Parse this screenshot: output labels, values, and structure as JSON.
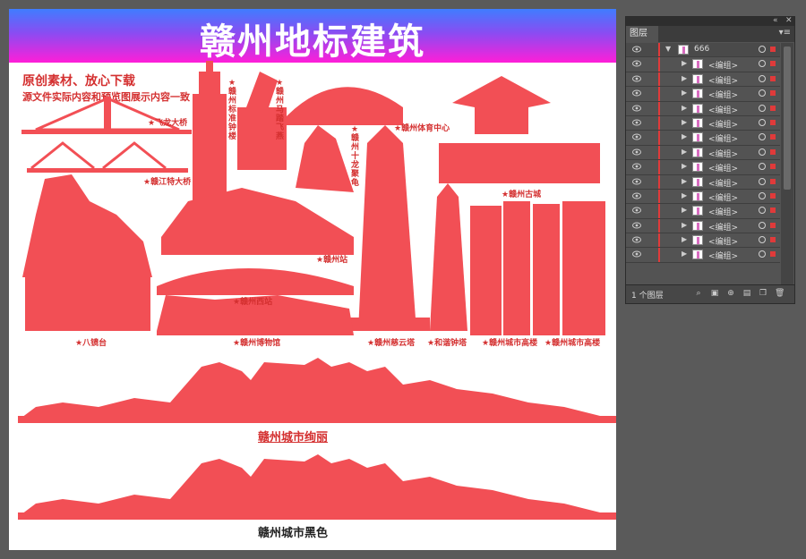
{
  "artboard": {
    "banner_title": "赣州地标建筑",
    "desc_line1": "原创素材、放心下载",
    "desc_line2": "源文件实际内容和预览图展示内容一致",
    "labels": {
      "feilong": "★飞龙大桥",
      "ganjiang": "★赣江特大桥",
      "biaozhun": "★赣州标准钟楼",
      "ma": "★赣州马踏飞燕",
      "tiyu": "★赣州体育中心",
      "shilong": "★赣州十龙聚龟",
      "gucheng": "★赣州古城",
      "station": "★赣州站",
      "west": "★赣州西站",
      "bajing": "★八镜台",
      "museum": "★赣州博物馆",
      "ciyun": "★赣州慈云塔",
      "hexie": "★和谐钟塔",
      "tower1": "★赣州城市高楼",
      "tower2": "★赣州城市高楼"
    },
    "caption_colorful": "赣州城市绚丽",
    "caption_black": "赣州城市黑色",
    "accent_color": "#f24f55"
  },
  "layers_panel": {
    "tab_label": "图层",
    "parent_layer": "666",
    "groups": [
      "<编组>",
      "<编组>",
      "<编组>",
      "<编组>",
      "<编组>",
      "<编组>",
      "<编组>",
      "<编组>",
      "<编组>",
      "<编组>",
      "<编组>",
      "<编组>",
      "<编组>",
      "<编组>"
    ],
    "footer_label": "1 个图层",
    "icons": [
      "eye-icon",
      "target-icon",
      "search-icon",
      "clipping-mask-icon",
      "new-sublayer-icon",
      "new-layer-icon",
      "trash-icon"
    ]
  }
}
